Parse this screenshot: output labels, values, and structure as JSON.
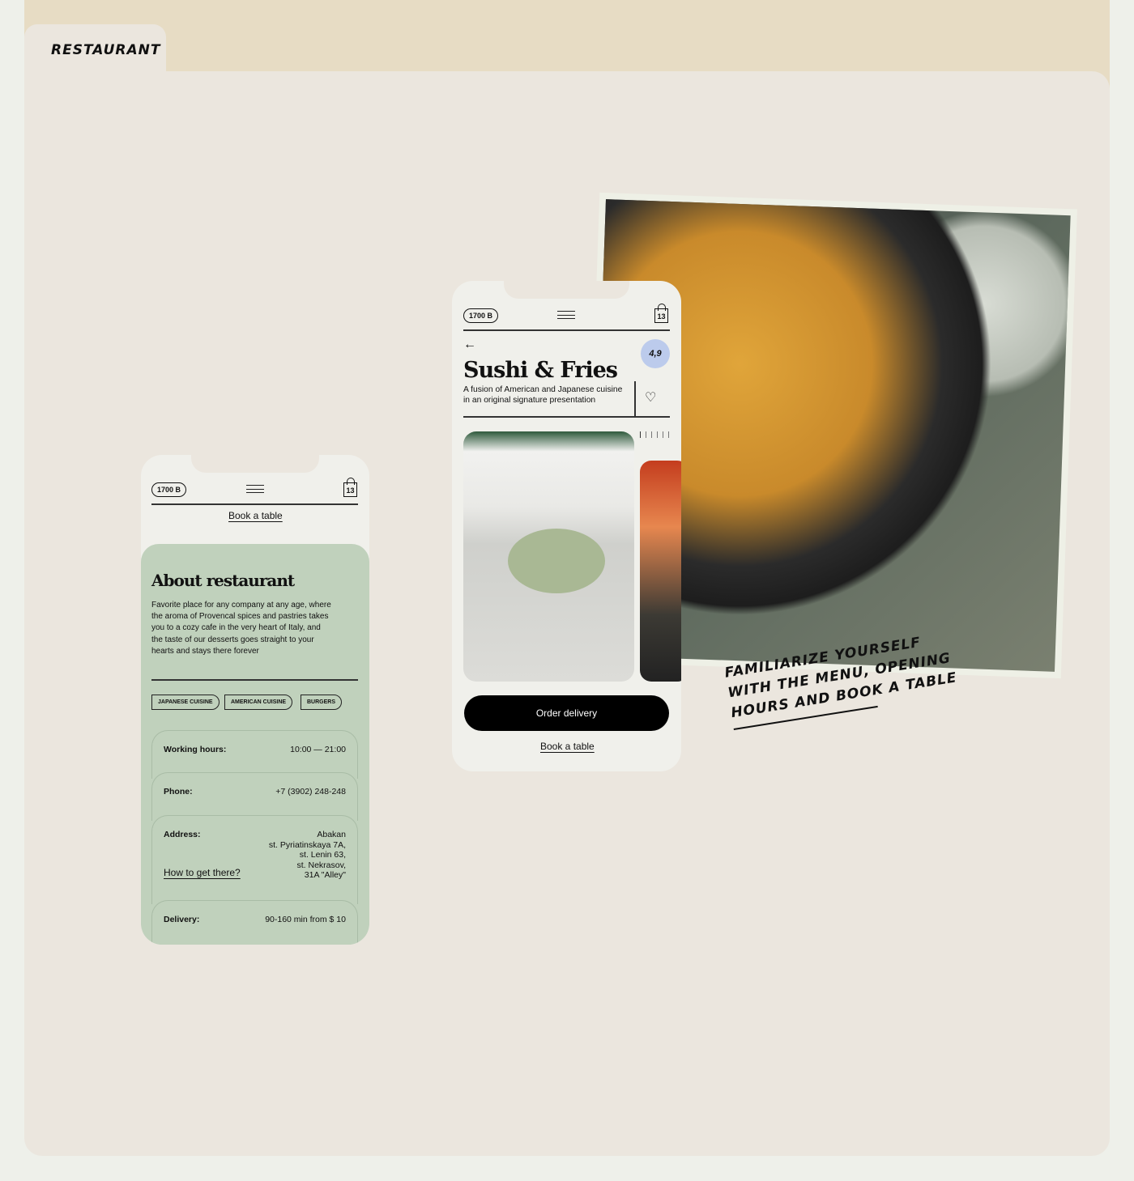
{
  "tab_label": "RESTAURANT",
  "caption": [
    "FAMILIARIZE YOURSELF",
    "WITH THE MENU, OPENING",
    "HOURS AND BOOK A TABLE"
  ],
  "phone_about": {
    "balance": "1700 B",
    "cart_count": "13",
    "book_link": "Book a table",
    "title": "About restaurant",
    "description": "Favorite place for any company at any age, where the aroma of Provencal spices and pastries takes you to a cozy cafe in the very heart of Italy, and the taste of our desserts goes straight to your hearts and stays there forever",
    "tags": [
      "JAPANESE CUISINE",
      "AMERICAN CUISINE",
      "BURGERS"
    ],
    "info": {
      "hours_label": "Working hours:",
      "hours_value": "10:00 — 21:00",
      "phone_label": "Phone:",
      "phone_value": "+7 (3902) 248-248",
      "address_label": "Address:",
      "address_lines": [
        "Abakan",
        "st. Pyriatinskaya 7A,",
        "st. Lenin 63,",
        "st. Nekrasov,",
        "31A \"Alley\""
      ],
      "directions_link": "How to get there?",
      "delivery_label": "Delivery:",
      "delivery_value": "90-160 min from $ 10"
    }
  },
  "phone_detail": {
    "balance": "1700 B",
    "cart_count": "13",
    "rating": "4,9",
    "title": "Sushi & Fries",
    "subtitle": "A fusion of American and Japanese cuisine in an original signature presentation",
    "order_button": "Order delivery",
    "book_link": "Book a table"
  },
  "colors": {
    "green": "#c0d1bc",
    "rating": "#bccbec",
    "beige": "#e7dcc4"
  }
}
